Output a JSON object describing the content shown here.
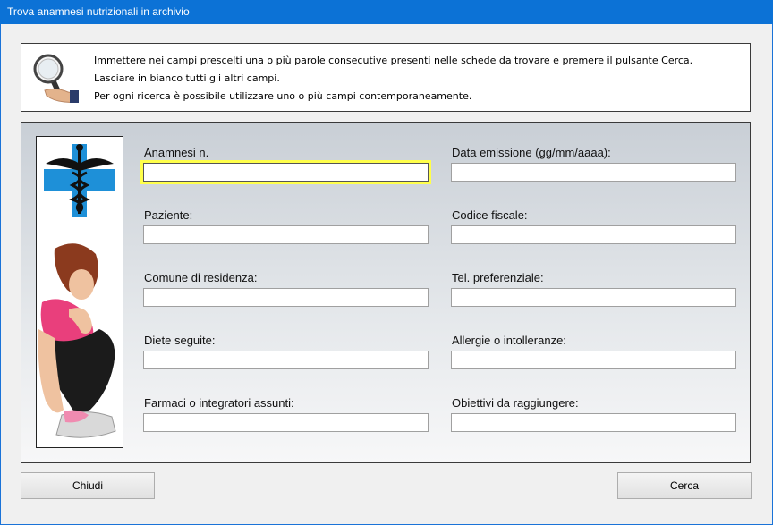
{
  "window": {
    "title": "Trova anamnesi nutrizionali in archivio"
  },
  "info": {
    "lines": [
      "Immettere nei campi prescelti una o più parole consecutive presenti nelle schede da trovare e premere il pulsante Cerca.",
      "Lasciare in bianco tutti gli altri campi.",
      "Per ogni ricerca è possibile utilizzare uno o più campi contemporaneamente."
    ]
  },
  "fields": {
    "anamnesi_n": {
      "label": "Anamnesi n.",
      "value": ""
    },
    "data_emissione": {
      "label": "Data emissione (gg/mm/aaaa):",
      "value": ""
    },
    "paziente": {
      "label": "Paziente:",
      "value": ""
    },
    "codice_fiscale": {
      "label": "Codice fiscale:",
      "value": ""
    },
    "comune": {
      "label": "Comune di residenza:",
      "value": ""
    },
    "tel": {
      "label": "Tel. preferenziale:",
      "value": ""
    },
    "diete": {
      "label": "Diete seguite:",
      "value": ""
    },
    "allergie": {
      "label": "Allergie o intolleranze:",
      "value": ""
    },
    "farmaci": {
      "label": "Farmaci o integratori assunti:",
      "value": ""
    },
    "obiettivi": {
      "label": "Obiettivi da raggiungere:",
      "value": ""
    }
  },
  "buttons": {
    "close": "Chiudi",
    "search": "Cerca"
  },
  "colors": {
    "titlebar": "#0c72d6",
    "focus_ring": "#ffff4a",
    "caduceus_cross": "#1e90d8"
  }
}
